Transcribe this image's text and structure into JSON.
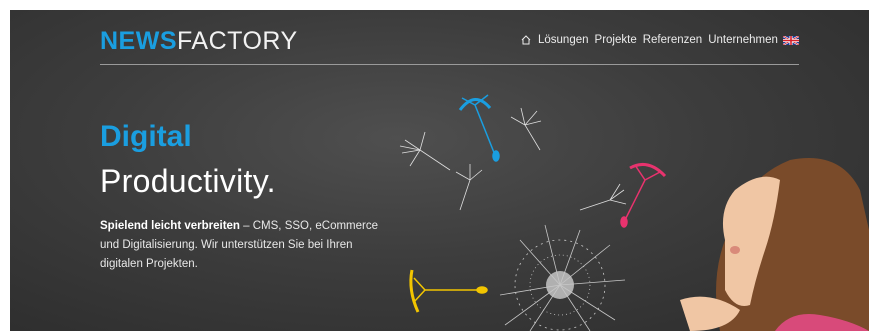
{
  "header": {
    "logo_part1": "NEWS",
    "logo_part2": "FACTORY",
    "nav": [
      {
        "label": "Lösungen"
      },
      {
        "label": "Projekte"
      },
      {
        "label": "Referenzen"
      },
      {
        "label": "Unternehmen"
      }
    ],
    "language_icon": "uk-flag-icon",
    "home_icon": "home-icon"
  },
  "hero": {
    "headline_accent": "Digital",
    "headline_main": "Productivity.",
    "lead_bold": "Spielend leicht verbreiten",
    "lead_rest": " – CMS, SSO, eCommerce und Digitalisierung. Wir unterstützen Sie bei Ihren digitalen Projekten."
  },
  "colors": {
    "brand_blue": "#1a9ee0",
    "background": "#3d3d3d",
    "seed_blue": "#1a9ee0",
    "seed_pink": "#e8336e",
    "seed_yellow": "#f2c500"
  }
}
